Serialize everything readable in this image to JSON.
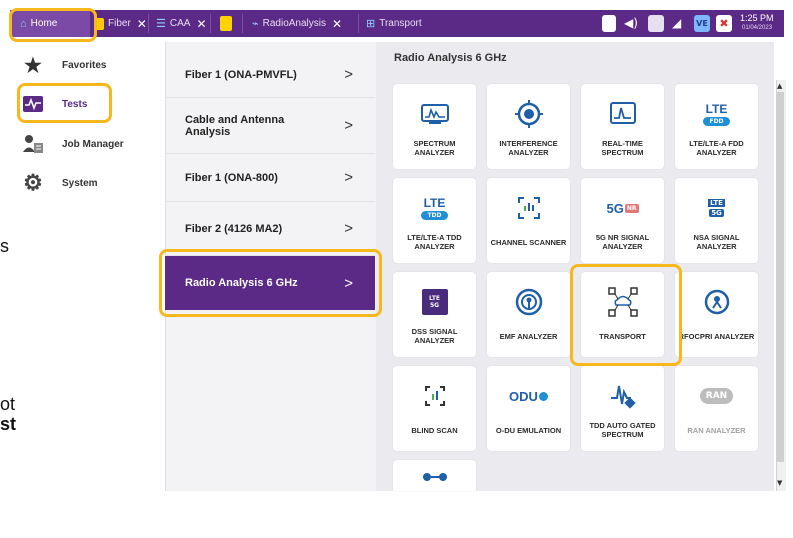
{
  "topbar": {
    "tabs": [
      {
        "label": "Home",
        "icon": "home-icon"
      },
      {
        "label": "Fiber",
        "icon": "fiber-icon"
      },
      {
        "label": "CAA",
        "icon": "caa-icon"
      },
      {
        "label": "",
        "icon": "folder-icon"
      },
      {
        "label": "RadioAnalysis",
        "icon": "radio-analysis-icon"
      },
      {
        "label": "Transport",
        "icon": "transport-icon"
      }
    ],
    "close_symbol": "✕",
    "time": "1:25 PM",
    "date": "01/04/2023",
    "status_badge": "VE"
  },
  "sidebar": {
    "items": [
      {
        "label": "Favorites",
        "icon": "star-icon"
      },
      {
        "label": "Tests",
        "icon": "tests-icon"
      },
      {
        "label": "Job Manager",
        "icon": "job-manager-icon"
      },
      {
        "label": "System",
        "icon": "gear-icon"
      }
    ]
  },
  "middle": {
    "items": [
      {
        "label": "Fiber 1 (ONA-PMVFL)",
        "chevron": ">"
      },
      {
        "label": "Cable and Antenna Analysis",
        "chevron": ">"
      },
      {
        "label": "Fiber 1 (ONA-800)",
        "chevron": ">"
      },
      {
        "label": "Fiber 2 (4126 MA2)",
        "chevron": ">"
      },
      {
        "label": "Radio Analysis 6 GHz",
        "chevron": ">"
      }
    ]
  },
  "right": {
    "title": "Radio Analysis 6 GHz",
    "tiles": [
      {
        "label": "SPECTRUM ANALYZER",
        "icon": "spectrum-analyzer-icon"
      },
      {
        "label": "INTERFERENCE ANALYZER",
        "icon": "interference-analyzer-icon"
      },
      {
        "label": "REAL-TIME SPECTRUM",
        "icon": "real-time-spectrum-icon"
      },
      {
        "label": "LTE/LTE-A FDD ANALYZER",
        "icon": "lte-fdd-icon",
        "badge_top": "LTE",
        "badge_bottom": "FDD"
      },
      {
        "label": "LTE/LTE-A TDD ANALYZER",
        "icon": "lte-tdd-icon",
        "badge_top": "LTE",
        "badge_bottom": "TDD"
      },
      {
        "label": "CHANNEL SCANNER",
        "icon": "channel-scanner-icon"
      },
      {
        "label": "5G NR SIGNAL ANALYZER",
        "icon": "5g-nr-icon",
        "badge_top": "5G",
        "badge_bottom": "NR"
      },
      {
        "label": "NSA SIGNAL ANALYZER",
        "icon": "nsa-signal-icon",
        "badge_top": "LTE",
        "badge_bottom": "5G"
      },
      {
        "label": "DSS SIGNAL ANALYZER",
        "icon": "dss-signal-icon",
        "badge_top": "LTE",
        "badge_bottom": "5G"
      },
      {
        "label": "EMF ANALYZER",
        "icon": "emf-analyzer-icon"
      },
      {
        "label": "TRANSPORT",
        "icon": "transport-network-icon"
      },
      {
        "label": "RFoCPRI ANALYZER",
        "icon": "rfocpri-icon"
      },
      {
        "label": "BLIND SCAN",
        "icon": "blind-scan-icon"
      },
      {
        "label": "O-DU EMULATION",
        "icon": "odu-emulation-icon",
        "badge_top": "ODU"
      },
      {
        "label": "TDD AUTO GATED SPECTRUM",
        "icon": "tdd-auto-gated-icon"
      },
      {
        "label": "RAN ANALYZER",
        "icon": "ran-analyzer-icon",
        "badge_top": "RAN"
      },
      {
        "label": "",
        "icon": "partial-tile-icon"
      }
    ]
  },
  "edge_text": {
    "s": "s",
    "ot": "ot",
    "st": "st"
  },
  "colors": {
    "brand_purple": "#5b2a86",
    "highlight": "#f6b81c",
    "tile_blue": "#1f5fa8",
    "accent_green": "#4caf50"
  }
}
